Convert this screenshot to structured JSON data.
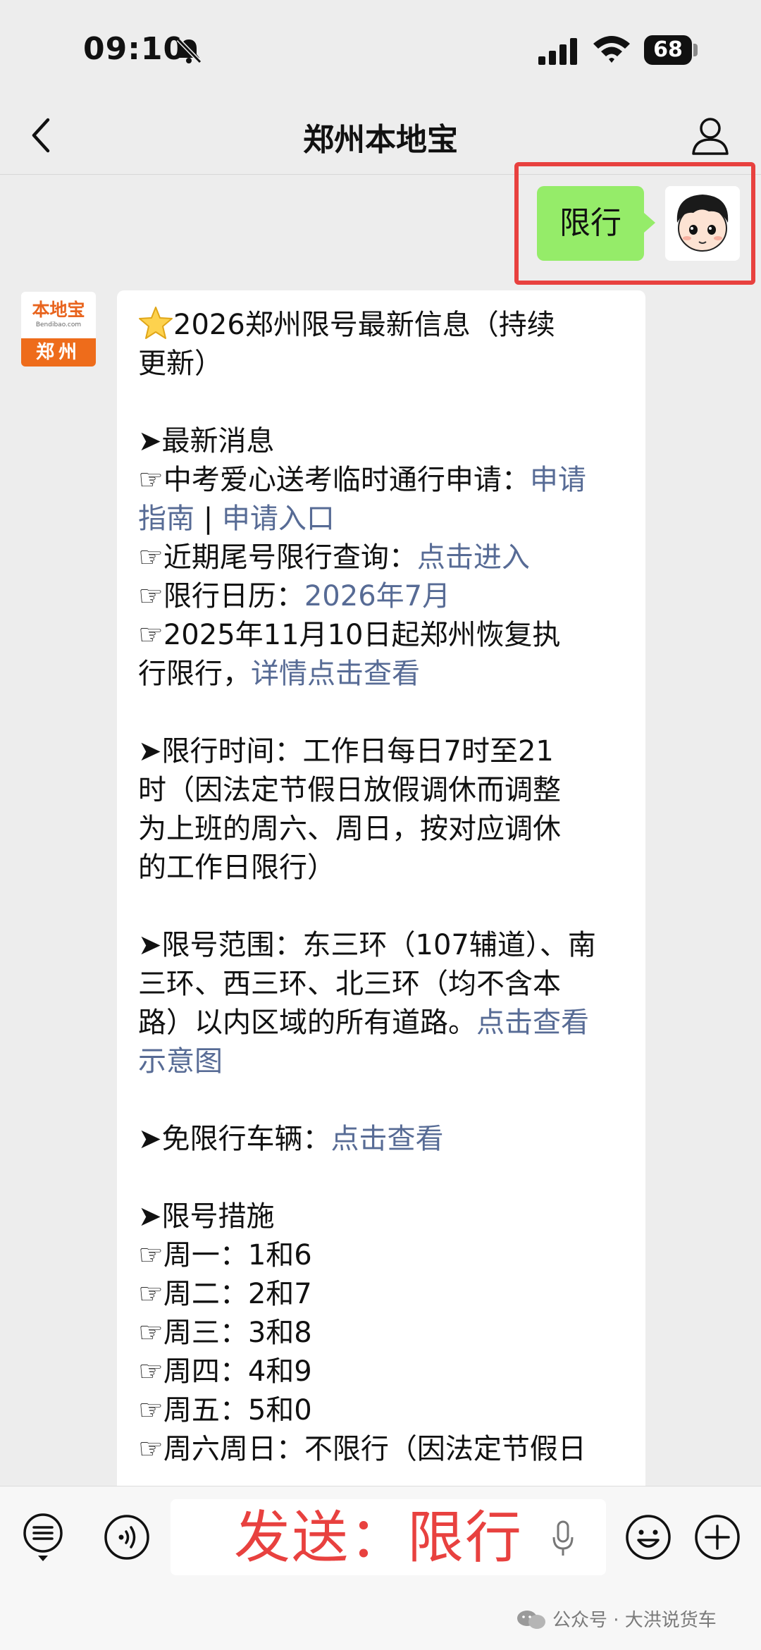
{
  "status_bar": {
    "time": "09:10",
    "battery": "68",
    "icons": [
      "bell-slash-icon",
      "signal-icon",
      "wifi-icon"
    ]
  },
  "header": {
    "title": "郑州本地宝",
    "back_icon": "chevron-left-icon",
    "profile_icon": "person-icon"
  },
  "outgoing": {
    "text": "限行"
  },
  "incoming": {
    "avatar": {
      "logo_text": "本地宝",
      "domain": "Bendibao.com",
      "city": "郑州"
    },
    "lines": {
      "title_1": "2026郑州限号最新信息（持续",
      "title_2": "更新）",
      "latest_heading": "➤最新消息",
      "l1a": "☞中考爱心送考临时通行申请：",
      "l1a_link": "申请",
      "l1b_link_a": "指南",
      "l1b_sep": " | ",
      "l1b_link_b": "申请入口",
      "l2": "☞近期尾号限行查询：",
      "l2_link": "点击进入",
      "l3": "☞限行日历：",
      "l3_link": "2026年7月",
      "l4": "☞2025年11月10日起郑州恢复执",
      "l5": "行限行，",
      "l5_link": "详情点击查看",
      "time_1": "➤限行时间：工作日每日7时至21",
      "time_2": "时（因法定节假日放假调休而调整",
      "time_3": "为上班的周六、周日，按对应调休",
      "time_4": "的工作日限行）",
      "range_1": "➤限号范围：东三环（107辅道）、南",
      "range_2": "三环、西三环、北三环（均不含本",
      "range_3": "路）以内区域的所有道路。",
      "range_3_link": "点击查看",
      "range_4_link": "示意图",
      "exempt": "➤免限行车辆：",
      "exempt_link": "点击查看",
      "measures": "➤限号措施",
      "mon": "☞周一：1和6",
      "tue": "☞周二：2和7",
      "wed": "☞周三：3和8",
      "thu": "☞周四：4和9",
      "fri": "☞周五：5和0",
      "weekend": "☞周六周日：不限行（因法定节假日"
    }
  },
  "input_bar": {
    "overlay_text": "发送：限行",
    "watermark": "公众号 · 大洪说货车",
    "icons": [
      "keyboard-list-icon",
      "voice-icon",
      "mic-icon",
      "emoji-icon",
      "plus-icon"
    ]
  },
  "colors": {
    "link": "#576b95",
    "outgoing_bubble": "#95ec69",
    "highlight": "#e8413f",
    "brand_orange": "#ee6c1b"
  }
}
